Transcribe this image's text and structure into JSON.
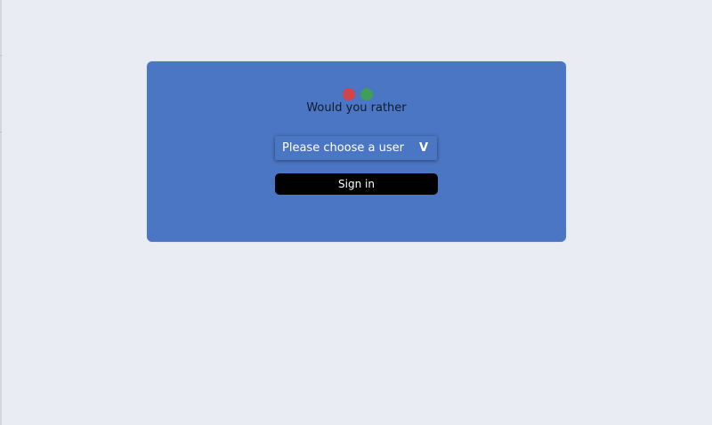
{
  "app": {
    "title": "Would you rather"
  },
  "logo": {
    "icon": "two-dots-logo-icon",
    "left_color": "#d0444a",
    "right_color": "#3e9e5a"
  },
  "login": {
    "user_select": {
      "selected": "Please choose a user",
      "chevron": "V",
      "icon": "chevron-down-icon"
    },
    "sign_in_label": "Sign in"
  },
  "colors": {
    "background": "#e9edf3",
    "card": "#4a76c3",
    "button": "#000000"
  }
}
